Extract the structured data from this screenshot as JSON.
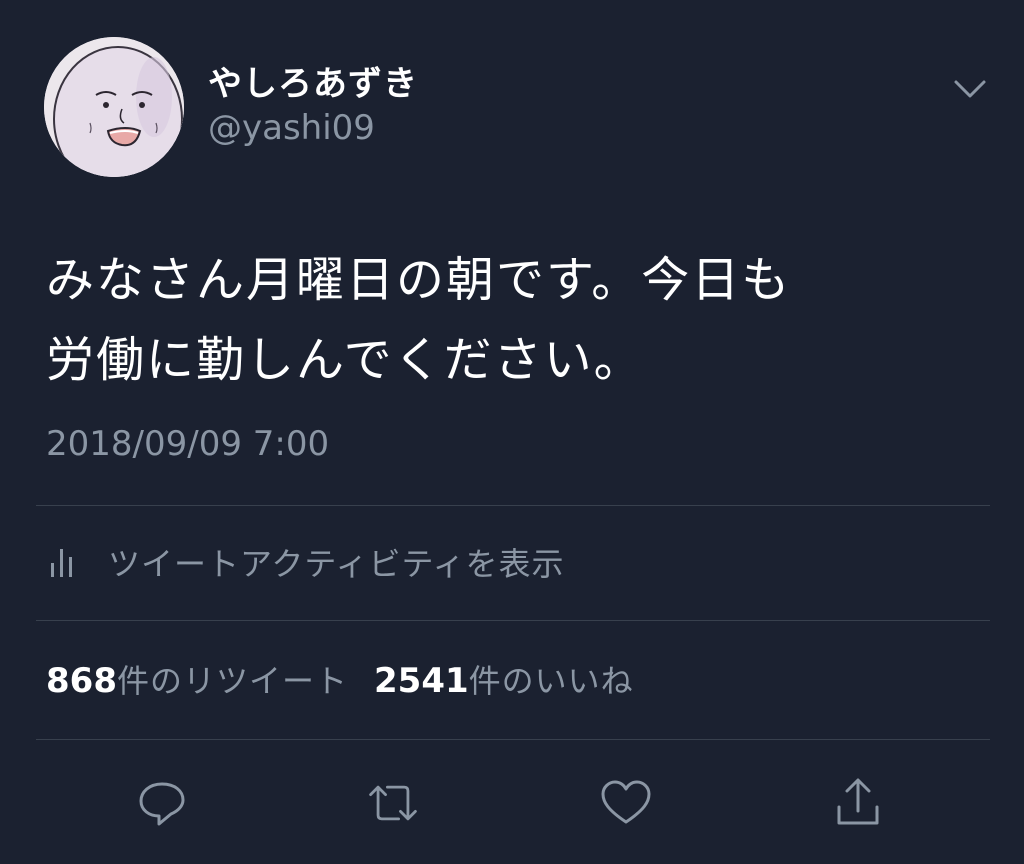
{
  "author": {
    "display_name": "やしろあずき",
    "handle": "@yashi09",
    "avatar": "avatar-cartoon-face"
  },
  "tweet": {
    "text": "みなさん月曜日の朝です。今日も\n労働に勤しんでください。",
    "timestamp": "2018/09/09 7:00"
  },
  "activity": {
    "label": "ツイートアクティビティを表示",
    "icon": "bar-chart-icon"
  },
  "stats": {
    "retweets_count": "868",
    "retweets_label": "件のリツイート",
    "likes_count": "2541",
    "likes_label": "件のいいね"
  },
  "actions": [
    "reply-icon",
    "retweet-icon",
    "like-icon",
    "share-icon"
  ],
  "colors": {
    "background": "#1b2130",
    "primary_text": "#ffffff",
    "secondary_text": "#8b96a4",
    "divider": "#38404d"
  }
}
